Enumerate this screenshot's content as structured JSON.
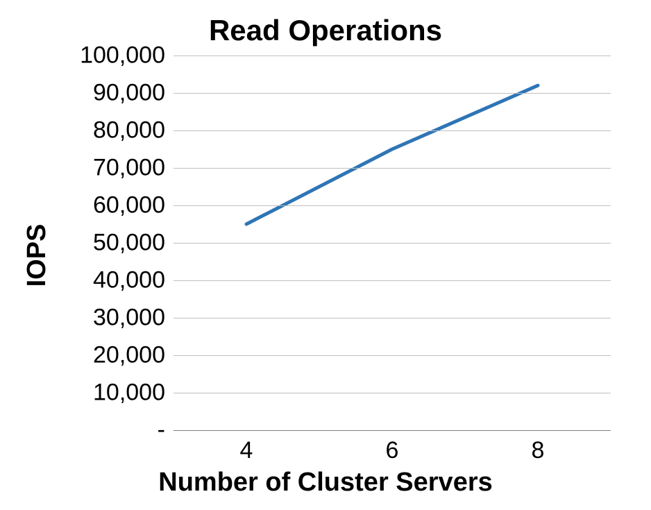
{
  "chart_data": {
    "type": "line",
    "title": "Read Operations",
    "xlabel": "Number of Cluster Servers",
    "ylabel": "IOPS",
    "x": [
      4,
      6,
      8
    ],
    "values": [
      55000,
      75000,
      92000
    ],
    "ylim": [
      0,
      100000
    ],
    "y_ticks": [
      0,
      10000,
      20000,
      30000,
      40000,
      50000,
      60000,
      70000,
      80000,
      90000,
      100000
    ],
    "y_tick_labels": [
      "-",
      "10,000",
      "20,000",
      "30,000",
      "40,000",
      "50,000",
      "60,000",
      "70,000",
      "80,000",
      "90,000",
      "100,000"
    ],
    "x_tick_labels": [
      "4",
      "6",
      "8"
    ],
    "line_color": "#2e75b6",
    "line_width": 5
  }
}
